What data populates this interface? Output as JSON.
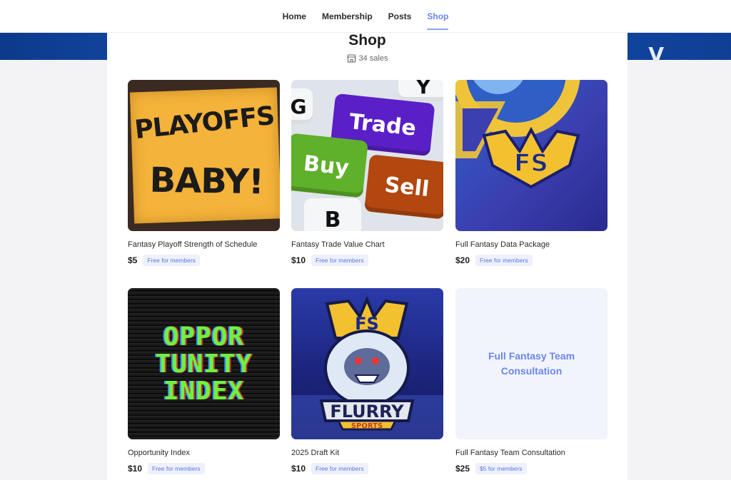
{
  "nav": {
    "items": [
      {
        "label": "Home"
      },
      {
        "label": "Membership"
      },
      {
        "label": "Posts"
      },
      {
        "label": "Shop",
        "active": true
      }
    ]
  },
  "shop": {
    "title": "Shop",
    "sales_text": "34 sales",
    "sales_icon": "store-icon"
  },
  "colors": {
    "accent": "#6a86f0",
    "badge_bg": "#eef1fc",
    "banner": "#1552b8"
  },
  "products": [
    {
      "name": "Fantasy Playoff Strength of Schedule",
      "price": "$5",
      "badge": "Free for members",
      "image_text": [
        "PLAYOFFS",
        "BABY!"
      ]
    },
    {
      "name": "Fantasy Trade Value Chart",
      "price": "$10",
      "badge": "Free for members",
      "image_text": [
        "G",
        "Y",
        "Trade",
        "Buy",
        "Sell",
        "B"
      ]
    },
    {
      "name": "Full Fantasy Data Package",
      "price": "$20",
      "badge": "Free for members",
      "image_text": [
        "FS"
      ]
    },
    {
      "name": "Opportunity Index",
      "price": "$10",
      "badge": "Free for members",
      "image_text": [
        "OPPOR",
        "TUNITY",
        "INDEX"
      ]
    },
    {
      "name": "2025 Draft Kit",
      "price": "$10",
      "badge": "Free for members",
      "image_text": [
        "FS",
        "FLURRY",
        "SPORTS"
      ]
    },
    {
      "name": "Full Fantasy Team Consultation",
      "price": "$25",
      "badge": "$5 for members",
      "image_text": [
        "Full Fantasy Team Consultation"
      ]
    }
  ]
}
